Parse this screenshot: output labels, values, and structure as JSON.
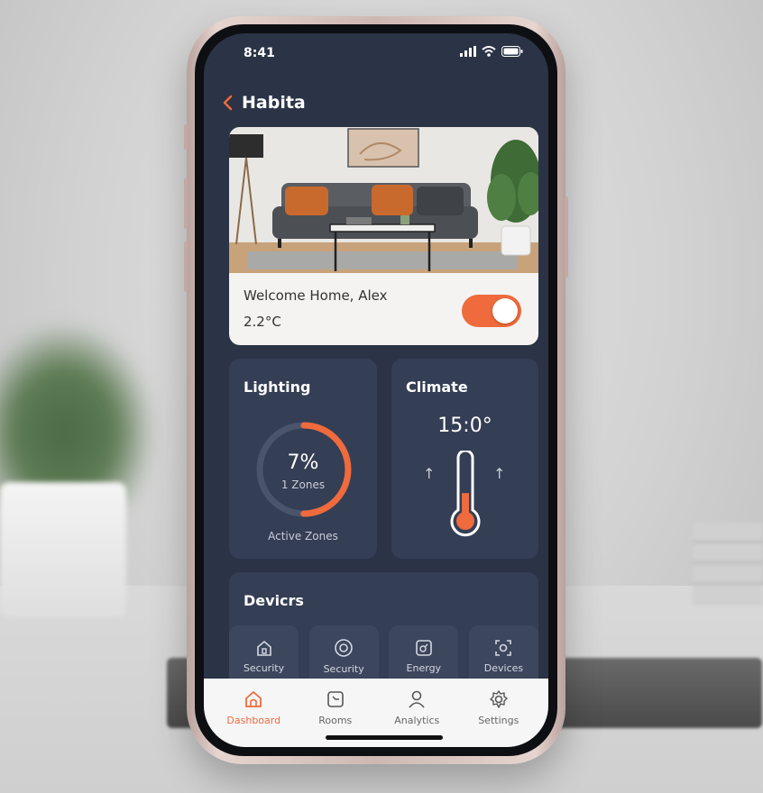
{
  "status_bar": {
    "time": "8:41"
  },
  "nav": {
    "title": "Habita",
    "back_icon": "chevron-left-icon"
  },
  "hero": {
    "greeting": "Welcome Home, Alex",
    "temperature": "2.2°C",
    "toggle_on": true
  },
  "lighting": {
    "title": "Lighting",
    "percent_label": "7%",
    "zones_label": "1 Zones",
    "caption": "Active Zones",
    "ring_fraction": 0.5
  },
  "climate": {
    "title": "Climate",
    "value": "15:0°",
    "thermometer_fill": 0.45
  },
  "devices": {
    "title": "Devicrs",
    "items": [
      {
        "label": "Security",
        "icon": "home-lock-icon"
      },
      {
        "label": "Security",
        "icon": "target-icon"
      },
      {
        "label": "Energy",
        "icon": "plug-icon"
      },
      {
        "label": "Devices",
        "icon": "scan-icon"
      }
    ]
  },
  "tabs": [
    {
      "label": "Dashboard",
      "icon": "home-icon",
      "active": true
    },
    {
      "label": "Rooms",
      "icon": "rooms-icon",
      "active": false
    },
    {
      "label": "Analytics",
      "icon": "user-icon",
      "active": false
    },
    {
      "label": "Settings",
      "icon": "gear-icon",
      "active": false
    }
  ],
  "colors": {
    "accent": "#ef6a3c",
    "screen_bg": "#2b3347",
    "card_bg": "#343e54"
  }
}
